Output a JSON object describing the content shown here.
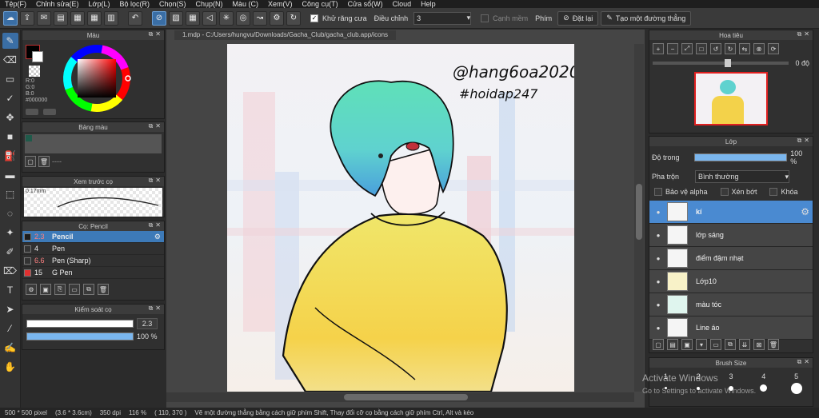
{
  "menu": [
    "Tệp(F)",
    "Chỉnh sửa(E)",
    "Lớp(L)",
    "Bộ lọc(R)",
    "Chọn(S)",
    "Chụp(N)",
    "Màu (C)",
    "Xem(V)",
    "Công cụ(T)",
    "Cửa sổ(W)",
    "Cloud",
    "Help"
  ],
  "toolbar": {
    "antialias_label": "Khử răng cưa",
    "adjust_label": "Điều chỉnh",
    "adjust_value": "3",
    "edge_label": "Cạnh mềm",
    "key_label": "Phím",
    "reset_label": "Đặt lại",
    "line_label": "Tạo một đường thẳng"
  },
  "document_tab": "1.mdp - C:/Users/hungvu/Downloads/Gacha_Club/gacha_club.app/icons",
  "artwork": {
    "signature1": "@hang6oa2020",
    "signature2": "#hoidap247"
  },
  "color_panel": {
    "title": "Màu",
    "r_label": "R:0",
    "g_label": "G:0",
    "b_label": "B:0",
    "hex": "#000000",
    "foreground": "#000000",
    "background": "#ffffff"
  },
  "palette_panel": {
    "title": "Bảng màu",
    "swatch": "#1f5a4a",
    "dots": "----"
  },
  "preview_panel": {
    "title": "Xem trước cọ",
    "size_label": "0.17mm"
  },
  "brush_panel": {
    "title": "Cọ: Pencil",
    "brushes": [
      {
        "size": "2.3",
        "name": "Pencil",
        "color": "#1c1c1c"
      },
      {
        "size": "4",
        "name": "Pen",
        "color": "#333333"
      },
      {
        "size": "6.6",
        "name": "Pen (Sharp)",
        "color": "#333333"
      },
      {
        "size": "15",
        "name": "G Pen",
        "color": "#e03030"
      }
    ]
  },
  "brush_control": {
    "title": "Kiểm soát cọ",
    "size_value": "2.3",
    "opacity_value": "100 %"
  },
  "navigator": {
    "title": "Hoa tiêu",
    "zoom_value": "0 độ"
  },
  "layers_panel": {
    "title": "Lớp",
    "opacity_label": "Độ trong",
    "opacity_value": "100 %",
    "blend_label": "Pha trộn",
    "blend_value": "Bình thường",
    "protect_alpha": "Bảo vệ alpha",
    "clipping": "Xén bớt",
    "lock": "Khóa",
    "layers": [
      "kí",
      "lớp sáng",
      "điểm đậm nhạt",
      "Lớp10",
      "màu tóc",
      "Line áo"
    ]
  },
  "brush_size_panel": {
    "title": "Brush Size",
    "sizes": [
      "1",
      "2",
      "3",
      "4",
      "5"
    ]
  },
  "status": {
    "dimensions": "500 * 500 pixel",
    "physical": "(3.6 * 3.6cm)",
    "dpi": "350 dpi",
    "zoom": "116 %",
    "coords": "( 110, 370 )",
    "hint": "Vẽ một đường thẳng bằng cách giữ phím Shift, Thay đổi cỡ cọ bằng cách giữ phím Ctrl, Alt và kéo"
  },
  "watermark": {
    "line1": "Activate Windows",
    "line2": "Go to Settings to activate Windows."
  }
}
